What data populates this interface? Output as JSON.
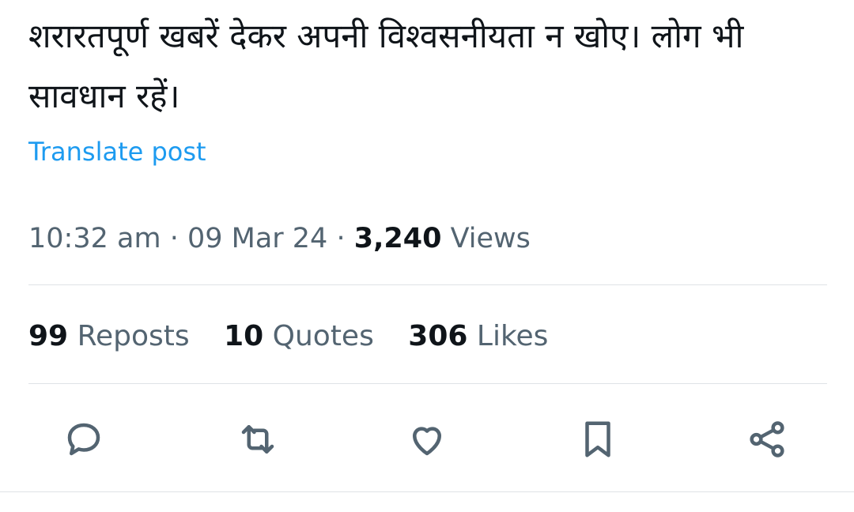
{
  "post": {
    "text": "शरारतपूर्ण खबरें देकर अपनी विश्वसनीयता न खोए। लोग भी सावधान रहें।",
    "translate_label": "Translate post"
  },
  "meta": {
    "time": "10:32 am",
    "separator": "·",
    "date": "09 Mar 24",
    "views_count": "3,240",
    "views_label": "Views"
  },
  "stats": {
    "reposts_count": "99",
    "reposts_label": "Reposts",
    "quotes_count": "10",
    "quotes_label": "Quotes",
    "likes_count": "306",
    "likes_label": "Likes"
  },
  "actions": {
    "icons": [
      "reply-icon",
      "repost-icon",
      "like-icon",
      "bookmark-icon",
      "share-icon"
    ]
  },
  "colors": {
    "text_primary": "#0f1419",
    "text_secondary": "#536471",
    "link": "#1d9bf0",
    "divider": "#dfe3e6"
  }
}
